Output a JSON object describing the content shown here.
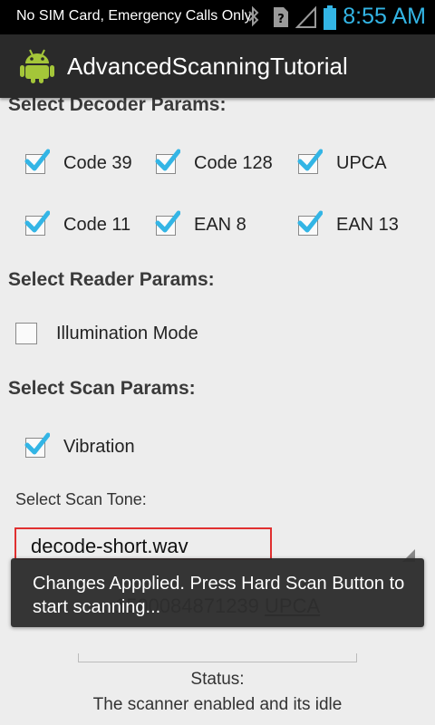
{
  "status_bar": {
    "carrier": "No SIM Card, Emergency Calls Only",
    "time": "8:55 AM",
    "accent_color": "#33b5e5"
  },
  "action_bar": {
    "title": "AdvancedScanningTutorial",
    "icon": "android-icon"
  },
  "decoder": {
    "title": "Select Decoder Params:",
    "items": [
      {
        "label": "Code 39",
        "checked": true
      },
      {
        "label": "Code 128",
        "checked": true
      },
      {
        "label": "UPCA",
        "checked": true
      },
      {
        "label": "Code 11",
        "checked": true
      },
      {
        "label": "EAN 8",
        "checked": true
      },
      {
        "label": "EAN 13",
        "checked": true
      }
    ]
  },
  "reader": {
    "title": "Select Reader Params:",
    "illumination_label": "Illumination Mode",
    "illumination_checked": false
  },
  "scan": {
    "title": "Select Scan Params:",
    "vibration_label": "Vibration",
    "vibration_checked": true,
    "tone_label": "Select Scan Tone:",
    "tone_value": "decode-short.wav"
  },
  "result": {
    "data": "1500084871239",
    "type": "UPCA"
  },
  "status": {
    "label": "Status:",
    "text": "The scanner enabled and its idle"
  },
  "toast": {
    "message": "Changes Appplied. Press Hard Scan Button to start scanning..."
  }
}
